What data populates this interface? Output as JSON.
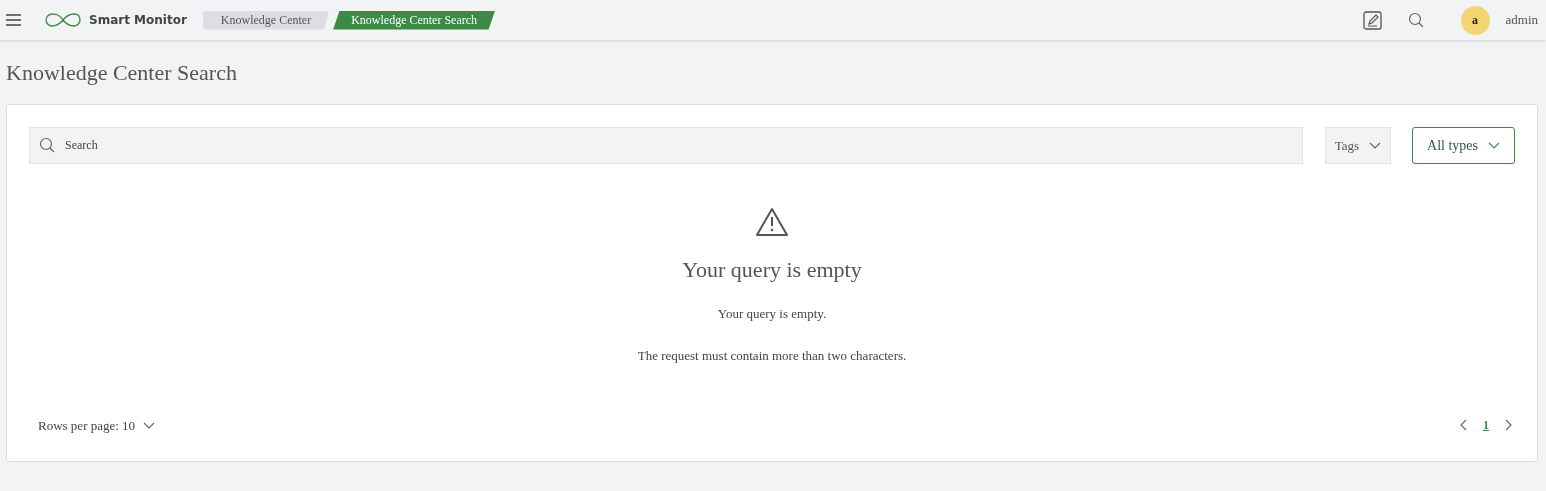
{
  "header": {
    "app_name": "Smart Monitor",
    "breadcrumbs": [
      {
        "label": "Knowledge Center",
        "selected": false
      },
      {
        "label": "Knowledge Center Search",
        "selected": true
      }
    ],
    "user": {
      "avatar_letter": "a",
      "name": "admin"
    }
  },
  "page_title": "Knowledge Center Search",
  "filters": {
    "search": {
      "placeholder": "Search"
    },
    "tags": {
      "label": "Tags"
    },
    "type": {
      "label": "All types"
    }
  },
  "empty_state": {
    "title": "Your query is empty",
    "message": "Your query is empty.",
    "hint": "The request must contain more than two characters."
  },
  "pagination": {
    "rows_per_page": "Rows per page: 10",
    "pages": [
      {
        "label": "1",
        "selected": true
      }
    ]
  }
}
